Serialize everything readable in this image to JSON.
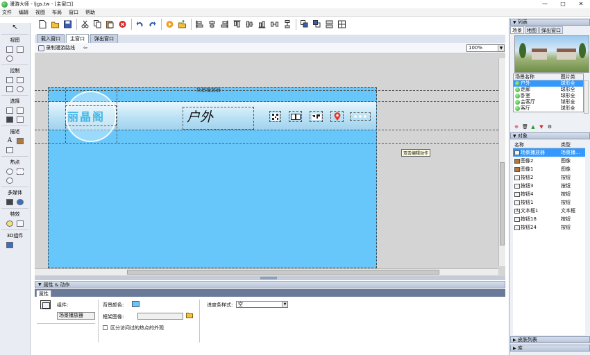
{
  "window": {
    "title": "漫游大师 - ljgs.tw - [主窗口]",
    "buttons": [
      "—",
      "□",
      "✕"
    ]
  },
  "menu": [
    "文件",
    "编辑",
    "视图",
    "布局",
    "窗口",
    "帮助"
  ],
  "left_panel": {
    "sections": [
      {
        "label": "视图"
      },
      {
        "label": "控制"
      },
      {
        "label": "选择"
      },
      {
        "label": "描述"
      },
      {
        "label": "热点"
      },
      {
        "label": "多媒体"
      },
      {
        "label": "特效"
      },
      {
        "label": "3D组件"
      }
    ],
    "describe_text_glyph": "A"
  },
  "doc_tabs": [
    "载入窗口",
    "主窗口",
    "弹出窗口"
  ],
  "subbar": {
    "record_label": "录制漫游路线",
    "back_glyph": "⇦"
  },
  "zoom": {
    "value": "100%"
  },
  "canvas": {
    "player_label": "场景播放器",
    "logo_text": "丽晶阁",
    "scene_text": "户外",
    "tooltip": "双击编辑动作"
  },
  "props": {
    "header": "属性 & 动作",
    "tab": "属性",
    "component_label": "组件:",
    "component_value": "场景播放器",
    "bgcolor_label": "背景颜色:",
    "bgcolor": "#67c6fa",
    "frame_label": "框架图像:",
    "distinguish_label": "区分访问过的热点的外观",
    "progress_label": "进度条样式:",
    "progress_value": "空"
  },
  "right_panel": {
    "list_header": "列表",
    "tabs": [
      "场景",
      "地图",
      "弹出窗口"
    ],
    "scene_cols": [
      "场景名称",
      "图片类"
    ],
    "scenes": [
      {
        "name": "户外",
        "type": "球形全"
      },
      {
        "name": "走廊",
        "type": "球形全"
      },
      {
        "name": "卧室",
        "type": "球形全"
      },
      {
        "name": "会客厅",
        "type": "球形全"
      },
      {
        "name": "客厅",
        "type": "球形全"
      }
    ],
    "objects_header": "对象",
    "object_cols": [
      "名称",
      "类型"
    ],
    "objects": [
      {
        "name": "场景播放器",
        "type": "场景播...",
        "icon": "player"
      },
      {
        "name": "图像2",
        "type": "图像",
        "icon": "image"
      },
      {
        "name": "图像1",
        "type": "图像",
        "icon": "image"
      },
      {
        "name": "按钮2",
        "type": "按钮",
        "icon": "button"
      },
      {
        "name": "按钮3",
        "type": "按钮",
        "icon": "button"
      },
      {
        "name": "按钮4",
        "type": "按钮",
        "icon": "button"
      },
      {
        "name": "按钮1",
        "type": "按钮",
        "icon": "button"
      },
      {
        "name": "文本框1",
        "type": "文本框",
        "icon": "text"
      },
      {
        "name": "按钮18",
        "type": "按钮",
        "icon": "button"
      },
      {
        "name": "按钮24",
        "type": "按钮",
        "icon": "button"
      }
    ],
    "skin_list_header": "皮肤列表",
    "library_header": "库"
  }
}
